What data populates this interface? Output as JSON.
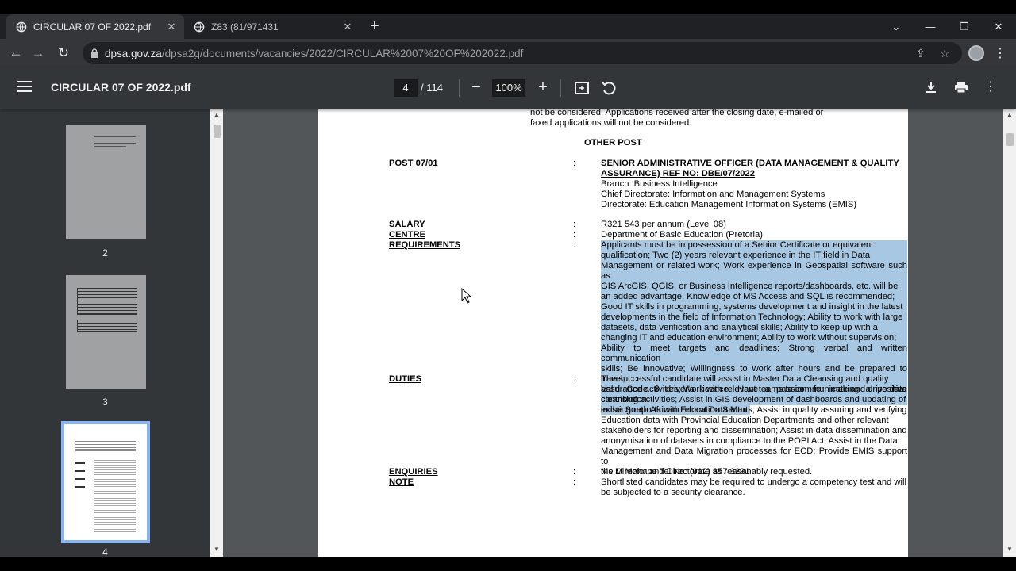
{
  "tabs": [
    {
      "title": "CIRCULAR 07 OF 2022.pdf",
      "active": true
    },
    {
      "title": "Z83 (81/971431",
      "active": false
    }
  ],
  "address": {
    "domain": "dpsa.gov.za",
    "path": "/dpsa2g/documents/vacancies/2022/CIRCULAR%2007%20OF%202022.pdf"
  },
  "pdf_toolbar": {
    "title": "CIRCULAR 07 OF 2022.pdf",
    "current_page": "4",
    "page_count": "/ 114",
    "zoom": "100%"
  },
  "thumbnails": [
    "2",
    "3",
    "4"
  ],
  "document": {
    "top_lines": [
      "not be considered. Applications received after the closing date, e-mailed or",
      "faxed applications will not be considered."
    ],
    "section_heading": "OTHER POST",
    "post": {
      "label": "POST 07/01",
      "title_lines": [
        "SENIOR ADMINISTRATIVE OFFICER (DATA MANAGEMENT & QUALITY",
        "ASSURANCE) REF NO: DBE/07/2022"
      ],
      "info": [
        "Branch: Business Intelligence",
        "Chief Directorate: Information and Management Systems",
        "Directorate: Education Management Information Systems (EMIS)"
      ]
    },
    "salary": {
      "label": "SALARY",
      "value": "R321 543 per annum (Level 08)"
    },
    "centre": {
      "label": "CENTRE",
      "value": "Department of Basic Education (Pretoria)"
    },
    "requirements": {
      "label": "REQUIREMENTS",
      "lines": [
        "Applicants must be in possession of a Senior Certificate or equivalent",
        "qualification; Two (2) years relevant experience in the IT field in Data",
        "Management or related work; Work experience in Geospatial software such as",
        "GIS ArcGIS, QGIS, or Business Intelligence reports/dashboards, etc. will be",
        "an added advantage; Knowledge of MS Access and SQL is recommended;",
        "Good IT skills in programming, systems development and insight in the latest",
        "developments in the field of Information Technology; Ability to work with large",
        "datasets, data verification and analytical skills; Ability to keep up with a",
        "changing IT and education environment; Ability to work without supervision;",
        "Ability to meet targets and deadlines; Strong verbal and written communication",
        "skills; Be innovative; Willingness to work after hours and be prepared to travel;",
        "Valid Code 8 driver's licence. Have a passion for making a positive contribution",
        "in the South African Education Sector."
      ]
    },
    "duties": {
      "label": "DUTIES",
      "lines": [
        "The successful candidate will assist in Master Data Cleansing and quality",
        "assurance activities; Work with relevant teams to communicate and drive data",
        "cleansing activities; Assist in GIS development of dashboards and updating of",
        "existing reports with recent Data Marts; Assist in quality assuring and verifying",
        "Education data with Provincial Education Departments and other relevant",
        "stakeholders for reporting and dissemination; Assist in data dissemination and",
        "anonymisation of datasets in compliance to the POPI Act; Assist in the Data",
        "Management and Data Migration processes for ECD; Provide EMIS support to",
        "the Director and Directorate as reasonably requested."
      ]
    },
    "enquiries": {
      "label": "ENQUIRIES",
      "value": "Ms M Mahape Tel No: (012) 357 3291"
    },
    "note": {
      "label": "NOTE",
      "lines": [
        "Shortlisted candidates may be required to undergo a competency test and will",
        "be subjected to a security clearance."
      ]
    },
    "colon": ":"
  }
}
